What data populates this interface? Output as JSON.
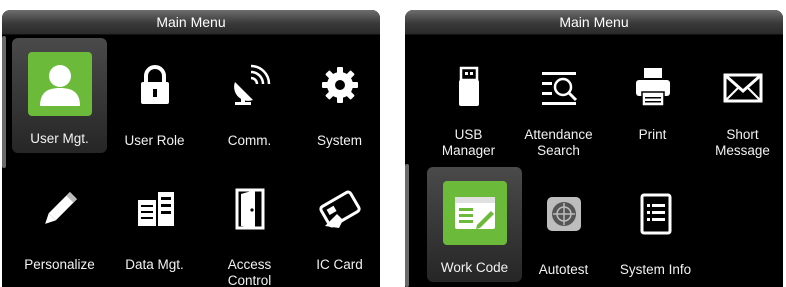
{
  "left": {
    "title": "Main Menu",
    "items": [
      {
        "label": "User Mgt.",
        "icon": "user-icon"
      },
      {
        "label": "User Role",
        "icon": "lock-icon"
      },
      {
        "label": "Comm.",
        "icon": "satellite-icon"
      },
      {
        "label": "System",
        "icon": "gear-icon"
      },
      {
        "label": "Personalize",
        "icon": "pencil-icon"
      },
      {
        "label": "Data Mgt.",
        "icon": "data-icon"
      },
      {
        "label": "Access Control",
        "icon": "door-icon"
      },
      {
        "label": "IC Card",
        "icon": "card-icon"
      }
    ]
  },
  "right": {
    "title": "Main Menu",
    "items": [
      {
        "label": "USB Manager",
        "icon": "usb-icon"
      },
      {
        "label": "Attendance Search",
        "icon": "search-icon"
      },
      {
        "label": "Print",
        "icon": "printer-icon"
      },
      {
        "label": "Short Message",
        "icon": "envelope-icon"
      },
      {
        "label": "Work Code",
        "icon": "work-code-icon"
      },
      {
        "label": "Autotest",
        "icon": "autotest-icon"
      },
      {
        "label": "System Info",
        "icon": "document-icon"
      }
    ]
  },
  "colors": {
    "selected_icon_bg": "#6cba3a",
    "screen_bg": "#000000",
    "text": "#ffffff"
  }
}
